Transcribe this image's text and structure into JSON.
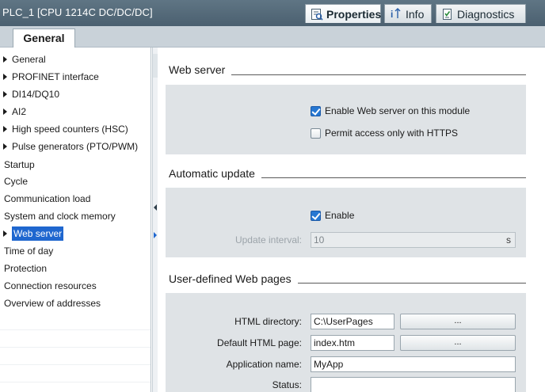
{
  "window": {
    "title": "PLC_1 [CPU 1214C DC/DC/DC]"
  },
  "inspector_tabs": [
    {
      "label": "Properties",
      "icon": "properties-icon",
      "active": true
    },
    {
      "label": "Info",
      "icon": "info-icon",
      "active": false
    },
    {
      "label": "Diagnostics",
      "icon": "diagnostics-icon",
      "active": false
    }
  ],
  "tabs": {
    "general": "General"
  },
  "nav": {
    "items": [
      {
        "label": "General",
        "expandable": true
      },
      {
        "label": "PROFINET interface",
        "expandable": true
      },
      {
        "label": "DI14/DQ10",
        "expandable": true
      },
      {
        "label": "AI2",
        "expandable": true
      },
      {
        "label": "High speed counters (HSC)",
        "expandable": true
      },
      {
        "label": "Pulse generators (PTO/PWM)",
        "expandable": true
      },
      {
        "label": "Startup",
        "expandable": false
      },
      {
        "label": "Cycle",
        "expandable": false
      },
      {
        "label": "Communication load",
        "expandable": false
      },
      {
        "label": "System and clock memory",
        "expandable": false
      },
      {
        "label": "Web server",
        "expandable": true,
        "selected": true
      },
      {
        "label": "Time of day",
        "expandable": false
      },
      {
        "label": "Protection",
        "expandable": false
      },
      {
        "label": "Connection resources",
        "expandable": false
      },
      {
        "label": "Overview of addresses",
        "expandable": false
      }
    ]
  },
  "web_server": {
    "title": "Web server",
    "enable_label": "Enable Web server on this module",
    "enable_checked": true,
    "https_label": "Permit access only with HTTPS",
    "https_checked": false
  },
  "automatic_update": {
    "title": "Automatic update",
    "enable_label": "Enable",
    "enable_checked": true,
    "interval_label": "Update interval:",
    "interval_value": "10",
    "interval_unit": "s"
  },
  "user_pages": {
    "title": "User-defined Web pages",
    "html_dir_label": "HTML directory:",
    "html_dir_value": "C:\\UserPages",
    "default_page_label": "Default HTML page:",
    "default_page_value": "index.htm",
    "app_name_label": "Application name:",
    "app_name_value": "MyApp",
    "status_label": "Status:",
    "status_value": "",
    "browse_label": "..."
  },
  "colors": {
    "titlebar": "#5f7584",
    "selection": "#1f67cf",
    "panel": "#dfe3e6"
  }
}
